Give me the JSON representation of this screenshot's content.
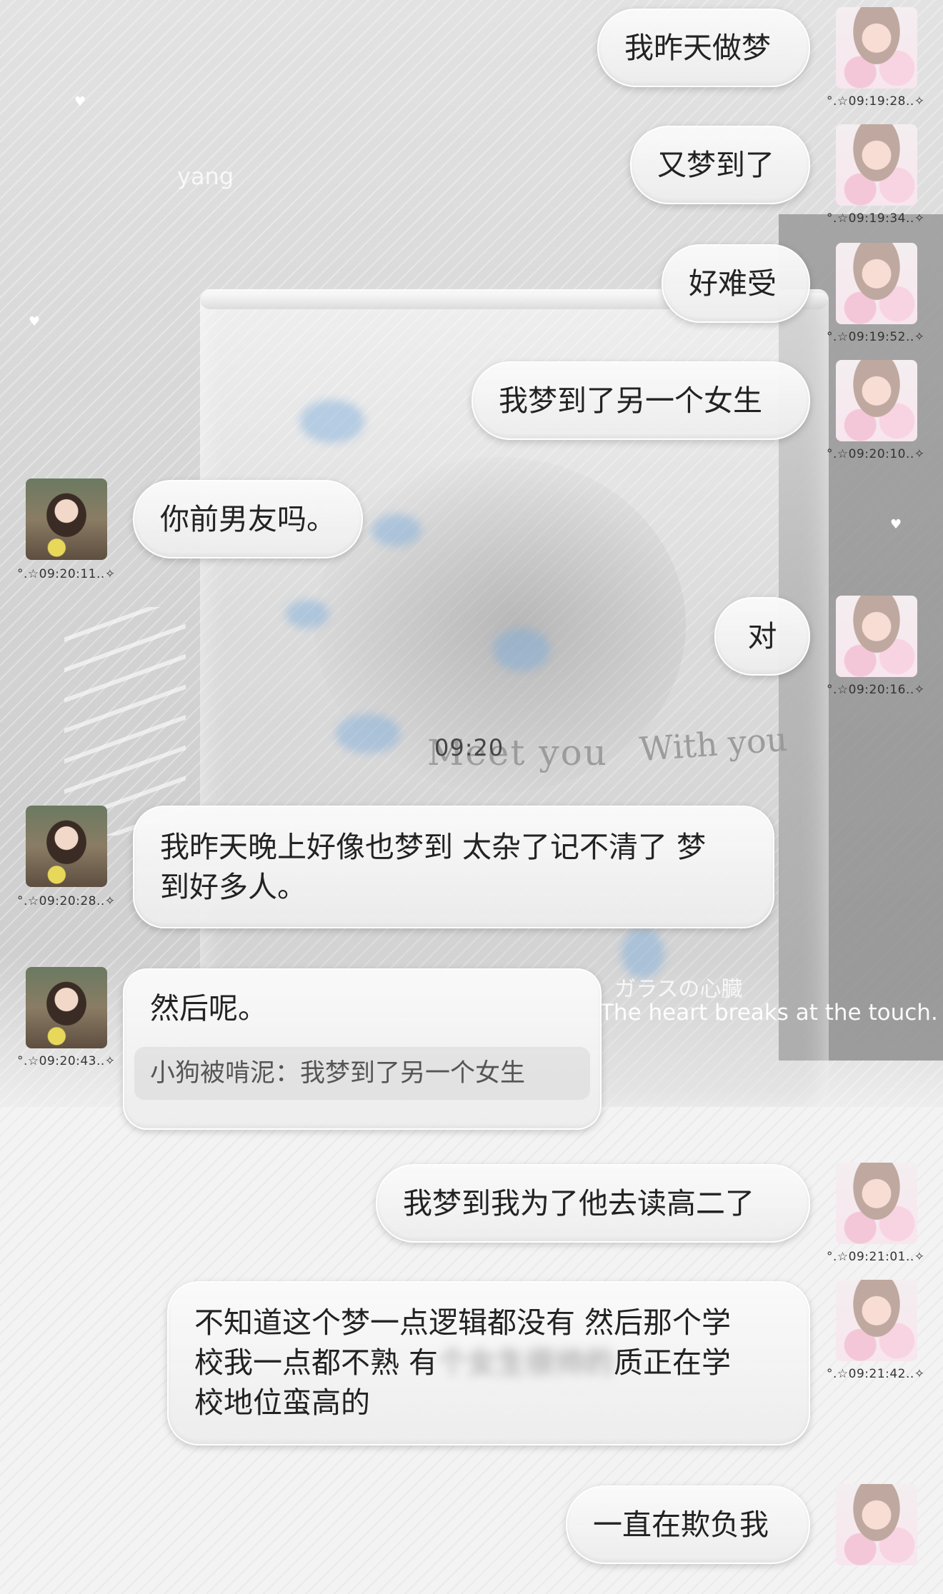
{
  "background": {
    "watermark_name": "yang",
    "center_time": "09:20",
    "text_meet": "Meet you",
    "text_with": "With you",
    "text_glass_jp": "ガラスの心臓",
    "text_heart": "The heart breaks at the touch."
  },
  "messages": [
    {
      "side": "right",
      "text": "我昨天做梦",
      "time": "°.☆09:19:28..✧"
    },
    {
      "side": "right",
      "text": "又梦到了",
      "time": "°.☆09:19:34..✧"
    },
    {
      "side": "right",
      "text": "好难受",
      "time": "°.☆09:19:52..✧"
    },
    {
      "side": "right",
      "text": "我梦到了另一个女生",
      "time": "°.☆09:20:10..✧"
    },
    {
      "side": "left",
      "text": "你前男友吗。",
      "time": "°.☆09:20:11..✧"
    },
    {
      "side": "right",
      "text": "对",
      "time": "°.☆09:20:16..✧"
    },
    {
      "side": "left",
      "line1": "我昨天晚上好像也梦到 太杂了记不清了 梦",
      "line2": "到好多人。",
      "time": "°.☆09:20:28..✧"
    },
    {
      "side": "left",
      "text": "然后呢。",
      "quote": "小狗被啃泥：我梦到了另一个女生",
      "time": "°.☆09:20:43..✧"
    },
    {
      "side": "right",
      "text": "我梦到我为了他去读高二了",
      "time": "°.☆09:21:01..✧"
    },
    {
      "side": "right",
      "line1": "不知道这个梦一点逻辑都没有 然后那个学",
      "line2_a": "校我一点都不熟 有",
      "line2_blur": "个女生很帅的",
      "line2_b": "质正在学",
      "line3": "校地位蛮高的",
      "time": "°.☆09:21:42..✧"
    },
    {
      "side": "right",
      "text": "一直在欺负我",
      "time": ""
    }
  ]
}
